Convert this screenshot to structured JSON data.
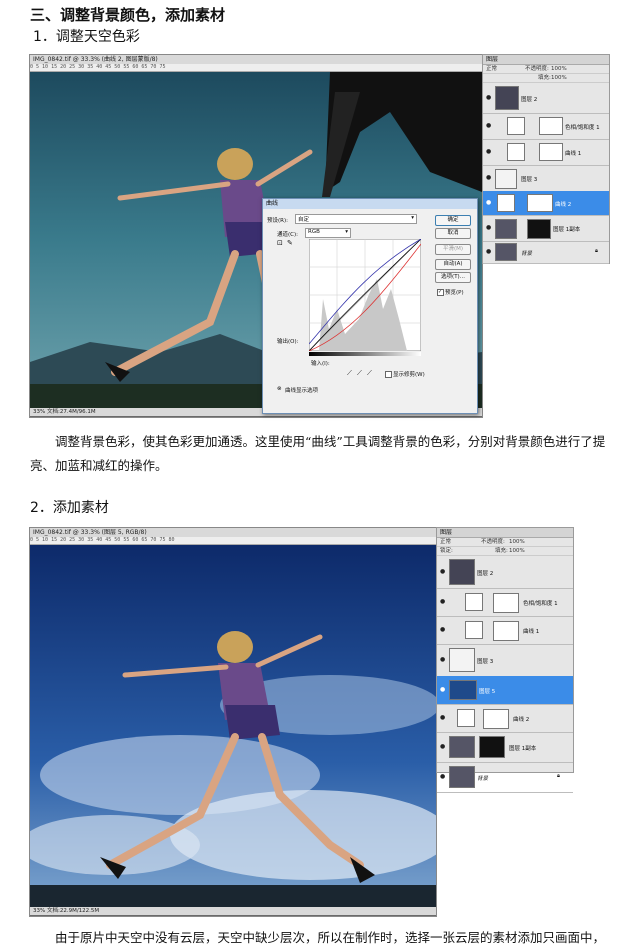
{
  "section_heading": "三、调整背景颜色，添加素材",
  "step1": {
    "heading": "1．调整天空色彩",
    "doc_title": "IMG_0842.tif @ 33.3% (曲线 2, 图层蒙版/8)",
    "ruler": "0   5   10   15   20   25   30   35   40   45   50   55   60   65   70   75",
    "status": "33%   文档:27.4M/96.1M",
    "layers_tab": "图层",
    "blend_mode": "正常",
    "opacity_label": "不透明度:",
    "opacity_value": "100%",
    "fill_label": "填充:",
    "fill_value": "100%",
    "layers": [
      {
        "name": "图层 2"
      },
      {
        "name": "色相/饱和度 1"
      },
      {
        "name": "曲线 1"
      },
      {
        "name": "图层 3"
      },
      {
        "name": "曲线 2"
      },
      {
        "name": "图层 1副本"
      },
      {
        "name": "背景"
      }
    ],
    "curves": {
      "title": "曲线",
      "preset_label": "预设(R):",
      "preset_value": "自定",
      "channel_label": "通道(C):",
      "channel_value": "RGB",
      "output_label": "输出(O):",
      "input_label": "输入(I):",
      "clip_label": "显示修剪(W)",
      "options_label": "曲线显示选项",
      "buttons": [
        "确定",
        "取消",
        "平滑(M)",
        "自动(A)",
        "选项(T)..."
      ],
      "preview_label": "预览(P)"
    },
    "description": "调整背景色彩，使其色彩更加通透。这里使用“曲线”工具调整背景的色彩，分别对背景颜色进行了提亮、加蓝和减红的操作。"
  },
  "step2": {
    "heading": "2．添加素材",
    "doc_title": "IMG_0842.tif @ 33.3% (图层 5, RGB/8)",
    "ruler": "0   5   10   15   20   25   30   35   40   45   50   55   60   65   70   75   80",
    "status": "33%   文档:22.9M/122.5M",
    "layers_tab": "图层",
    "blend_mode": "正常",
    "opacity_label": "不透明度:",
    "opacity_value": "100%",
    "fill_label": "填充:",
    "fill_value": "100%",
    "lock_label": "锁定:",
    "layers": [
      {
        "name": "图层 2"
      },
      {
        "name": "色相/饱和度 1"
      },
      {
        "name": "曲线 1"
      },
      {
        "name": "图层 3"
      },
      {
        "name": "图层 5"
      },
      {
        "name": "曲线 2"
      },
      {
        "name": "图层 1副本"
      },
      {
        "name": "背景"
      }
    ],
    "description": "由于原片中天空中没有云层，天空中缺少层次，所以在制作时，选择一张云层的素材添加只画面中，"
  }
}
